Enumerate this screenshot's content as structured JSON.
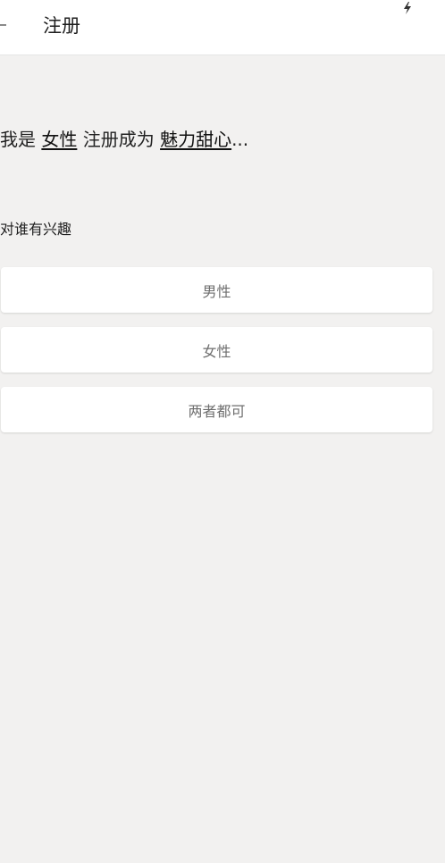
{
  "header": {
    "title": "注册"
  },
  "intro": {
    "prefix": "我是",
    "gender": "女性",
    "middle": "注册成为",
    "role": "魅力甜心",
    "suffix": "..."
  },
  "interest": {
    "label": "对谁有兴趣",
    "options": [
      {
        "label": "男性"
      },
      {
        "label": "女性"
      },
      {
        "label": "两者都可"
      }
    ]
  },
  "icons": {
    "back": "back-arrow-icon",
    "flash": "flash-icon"
  }
}
